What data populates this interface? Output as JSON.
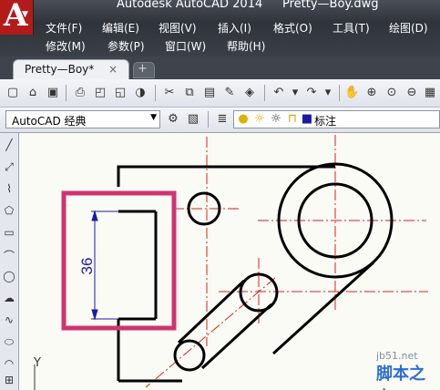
{
  "window": {
    "app_title": "Autodesk AutoCAD 2014",
    "file_name": "Pretty—Boy.dwg"
  },
  "menubar": {
    "row1": [
      "文件(F)",
      "编辑(E)",
      "视图(V)",
      "插入(I)",
      "格式(O)",
      "工具(T)",
      "绘图(D)"
    ],
    "row2": [
      "修改(M)",
      "参数(P)",
      "窗口(W)",
      "帮助(H)"
    ]
  },
  "tabs": {
    "active": "Pretty—Boy*",
    "close_glyph": "×",
    "new_tab_glyph": "+"
  },
  "toolbar": {
    "workspace_value": "AutoCAD 经典",
    "layer_name": "标注"
  },
  "drawing": {
    "dimension_text": "36",
    "ucs_label": "Y",
    "highlight_color": "#d0336e",
    "centerline_color": "#d62020",
    "line_color": "#000000"
  },
  "watermark": {
    "site": "jb51.net",
    "brand": "脚本之家"
  }
}
